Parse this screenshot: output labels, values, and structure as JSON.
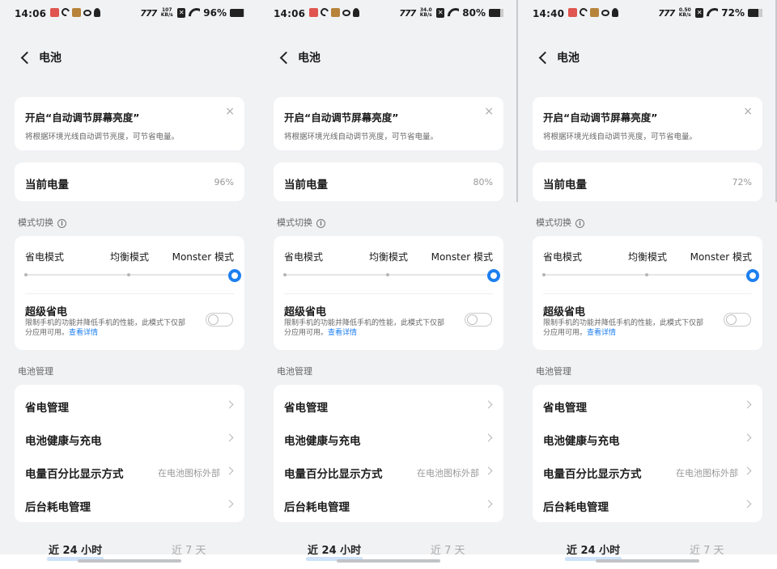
{
  "panels": [
    {
      "status": {
        "time": "14:06",
        "speed_value": "107",
        "speed_unit": "KB/s",
        "battery_pct": "96%",
        "battery_fill": 0.96
      },
      "header": {
        "title": "电池"
      },
      "tip": {
        "title": "开启“自动调节屏幕亮度”",
        "subtitle": "将根据环境光线自动调节亮度，可节省电量。",
        "close": "×"
      },
      "level": {
        "label": "当前电量",
        "value": "96%"
      },
      "mode_section": {
        "label": "模式切换",
        "info": "i"
      },
      "modes": [
        "省电模式",
        "均衡模式",
        "Monster 模式"
      ],
      "super_saver": {
        "title": "超级省电",
        "desc": "限制手机的功能并降低手机的性能，此模式下仅部分应用可用。",
        "link": "查看详情"
      },
      "mgmt_section": "电池管理",
      "rows": [
        {
          "label": "省电管理",
          "value": ""
        },
        {
          "label": "电池健康与充电",
          "value": ""
        },
        {
          "label": "电量百分比显示方式",
          "value": "在电池图标外部"
        },
        {
          "label": "后台耗电管理",
          "value": ""
        }
      ],
      "tabs": [
        "近 24 小时",
        "近 7 天"
      ]
    },
    {
      "status": {
        "time": "14:06",
        "speed_value": "34.0",
        "speed_unit": "KB/s",
        "battery_pct": "80%",
        "battery_fill": 0.8
      },
      "header": {
        "title": "电池"
      },
      "tip": {
        "title": "开启“自动调节屏幕亮度”",
        "subtitle": "将根据环境光线自动调节亮度，可节省电量。",
        "close": "×"
      },
      "level": {
        "label": "当前电量",
        "value": "80%"
      },
      "mode_section": {
        "label": "模式切换",
        "info": "i"
      },
      "modes": [
        "省电模式",
        "均衡模式",
        "Monster 模式"
      ],
      "super_saver": {
        "title": "超级省电",
        "desc": "限制手机的功能并降低手机的性能，此模式下仅部分应用可用。",
        "link": "查看详情"
      },
      "mgmt_section": "电池管理",
      "rows": [
        {
          "label": "省电管理",
          "value": ""
        },
        {
          "label": "电池健康与充电",
          "value": ""
        },
        {
          "label": "电量百分比显示方式",
          "value": "在电池图标外部"
        },
        {
          "label": "后台耗电管理",
          "value": ""
        }
      ],
      "tabs": [
        "近 24 小时",
        "近 7 天"
      ]
    },
    {
      "status": {
        "time": "14:40",
        "speed_value": "0.50",
        "speed_unit": "KB/s",
        "battery_pct": "72%",
        "battery_fill": 0.72
      },
      "header": {
        "title": "电池"
      },
      "tip": {
        "title": "开启“自动调节屏幕亮度”",
        "subtitle": "将根据环境光线自动调节亮度，可节省电量。",
        "close": "×"
      },
      "level": {
        "label": "当前电量",
        "value": "72%"
      },
      "mode_section": {
        "label": "模式切换",
        "info": "i"
      },
      "modes": [
        "省电模式",
        "均衡模式",
        "Monster 模式"
      ],
      "super_saver": {
        "title": "超级省电",
        "desc": "限制手机的功能并降低手机的性能，此模式下仅部分应用可用。",
        "link": "查看详情"
      },
      "mgmt_section": "电池管理",
      "rows": [
        {
          "label": "省电管理",
          "value": ""
        },
        {
          "label": "电池健康与充电",
          "value": ""
        },
        {
          "label": "电量百分比显示方式",
          "value": "在电池图标外部"
        },
        {
          "label": "后台耗电管理",
          "value": ""
        }
      ],
      "tabs": [
        "近 24 小时",
        "近 7 天"
      ]
    }
  ]
}
